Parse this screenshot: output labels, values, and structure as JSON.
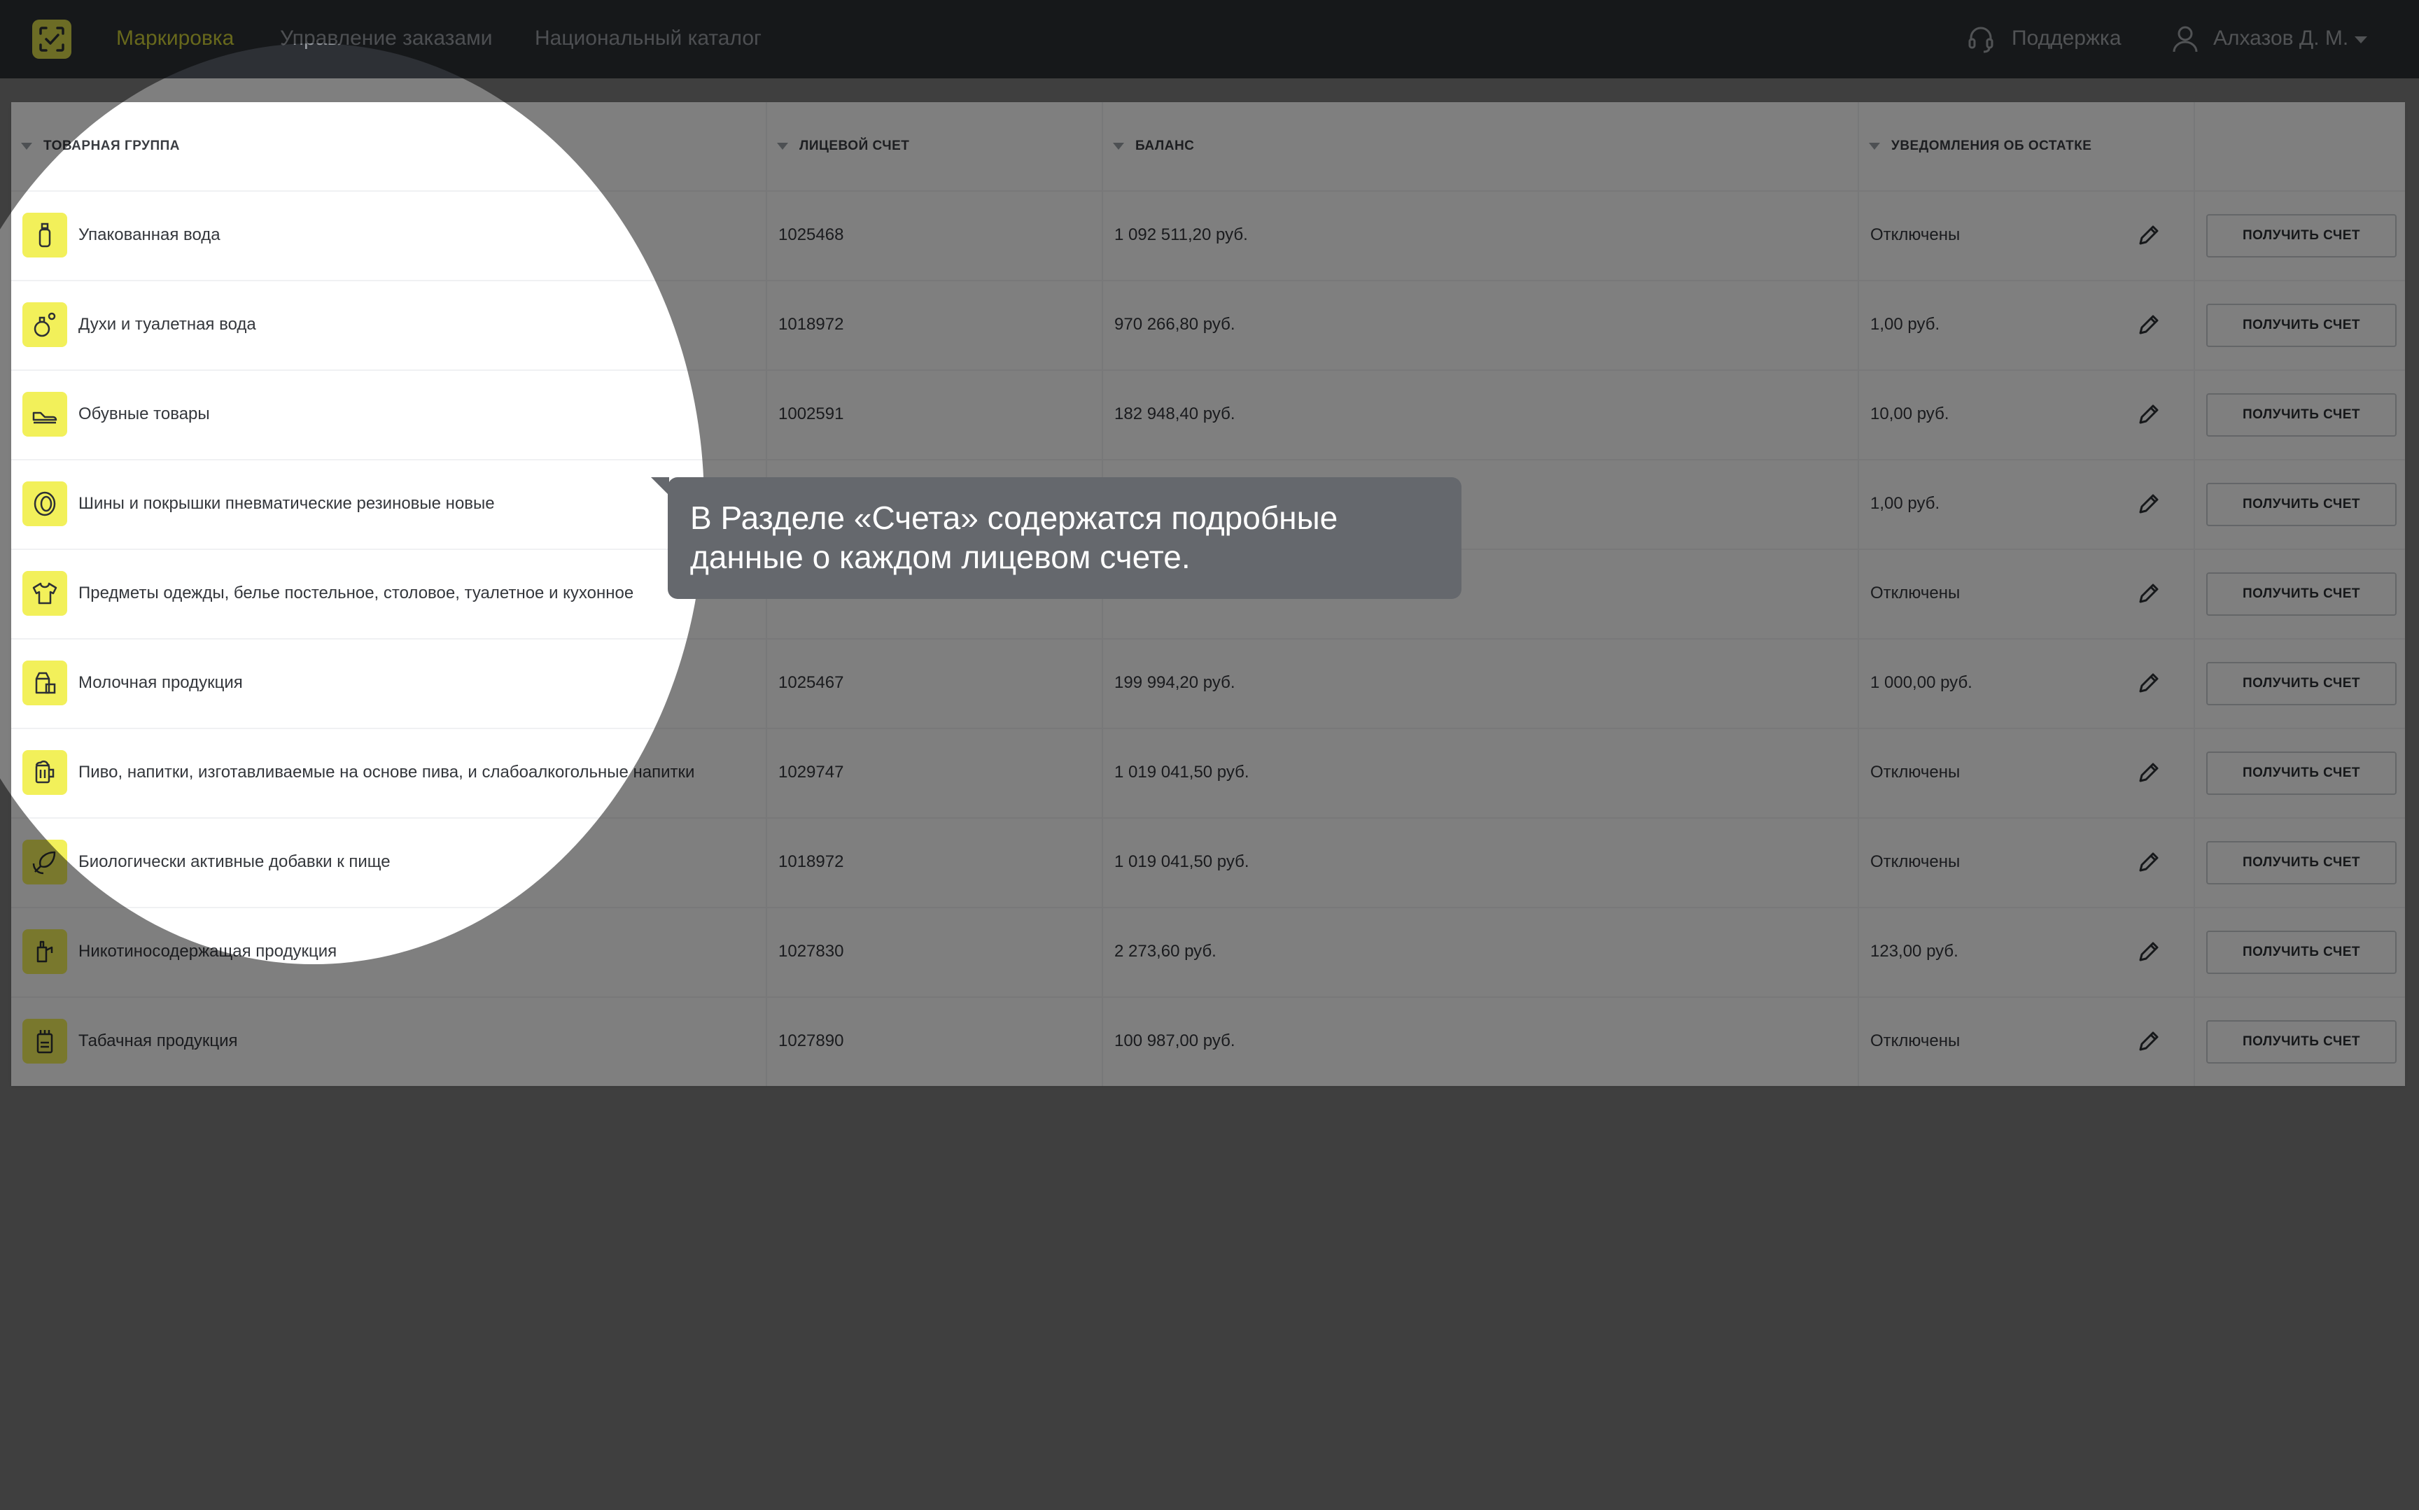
{
  "nav": {
    "logo_icon": "marking-logo-icon",
    "links": [
      "Маркировка",
      "Управление заказами",
      "Национальный каталог"
    ],
    "active_link": "Маркировка",
    "support_label": "Поддержка",
    "user_name": "Алхазов Д. М.",
    "accent_color": "#cfd039"
  },
  "table": {
    "headers": {
      "group": "ТОВАРНАЯ ГРУППА",
      "account": "ЛИЦЕВОЙ СЧЕТ",
      "balance": "БАЛАНС",
      "notifications": "УВЕДОМЛЕНИЯ ОБ ОСТАТКЕ"
    },
    "button_label": "ПОЛУЧИТЬ СЧЕТ",
    "rows": [
      {
        "icon": "water-bottle-icon",
        "group": "Упакованная вода",
        "account": "1025468",
        "balance": "1 092 511,20 руб.",
        "notification": "Отключены"
      },
      {
        "icon": "perfume-icon",
        "group": "Духи и туалетная вода",
        "account": "1018972",
        "balance": "970 266,80 руб.",
        "notification": "1,00 руб."
      },
      {
        "icon": "shoe-icon",
        "group": "Обувные товары",
        "account": "1002591",
        "balance": "182 948,40 руб.",
        "notification": "10,00 руб."
      },
      {
        "icon": "tire-icon",
        "group": "Шины и покрышки пневматические резиновые новые",
        "account": "",
        "balance": "",
        "notification": "1,00 руб."
      },
      {
        "icon": "shirt-icon",
        "group": "Предметы одежды, белье постельное, столовое, туалетное и кухонное",
        "account": "",
        "balance": "",
        "notification": "Отключены"
      },
      {
        "icon": "milk-icon",
        "group": "Молочная продукция",
        "account": "1025467",
        "balance": "199 994,20 руб.",
        "notification": "1 000,00 руб."
      },
      {
        "icon": "beer-icon",
        "group": "Пиво, напитки, изготавливаемые на основе пива, и слабоалкогольные напитки",
        "account": "1029747",
        "balance": "1 019 041,50 руб.",
        "notification": "Отключены"
      },
      {
        "icon": "leaf-supplement-icon",
        "group": "Биологически активные добавки к пище",
        "account": "1018972",
        "balance": "1 019 041,50 руб.",
        "notification": "Отключены"
      },
      {
        "icon": "vape-icon",
        "group": "Никотиносодержащая продукция",
        "account": "1027830",
        "balance": "2 273,60 руб.",
        "notification": "123,00 руб."
      },
      {
        "icon": "tobacco-icon",
        "group": "Табачная продукция",
        "account": "1027890",
        "balance": "100 987,00 руб.",
        "notification": "Отключены"
      }
    ]
  },
  "tooltip": {
    "text": "В Разделе «Счета» содержатся подробные данные о каждом лицевом счете."
  }
}
